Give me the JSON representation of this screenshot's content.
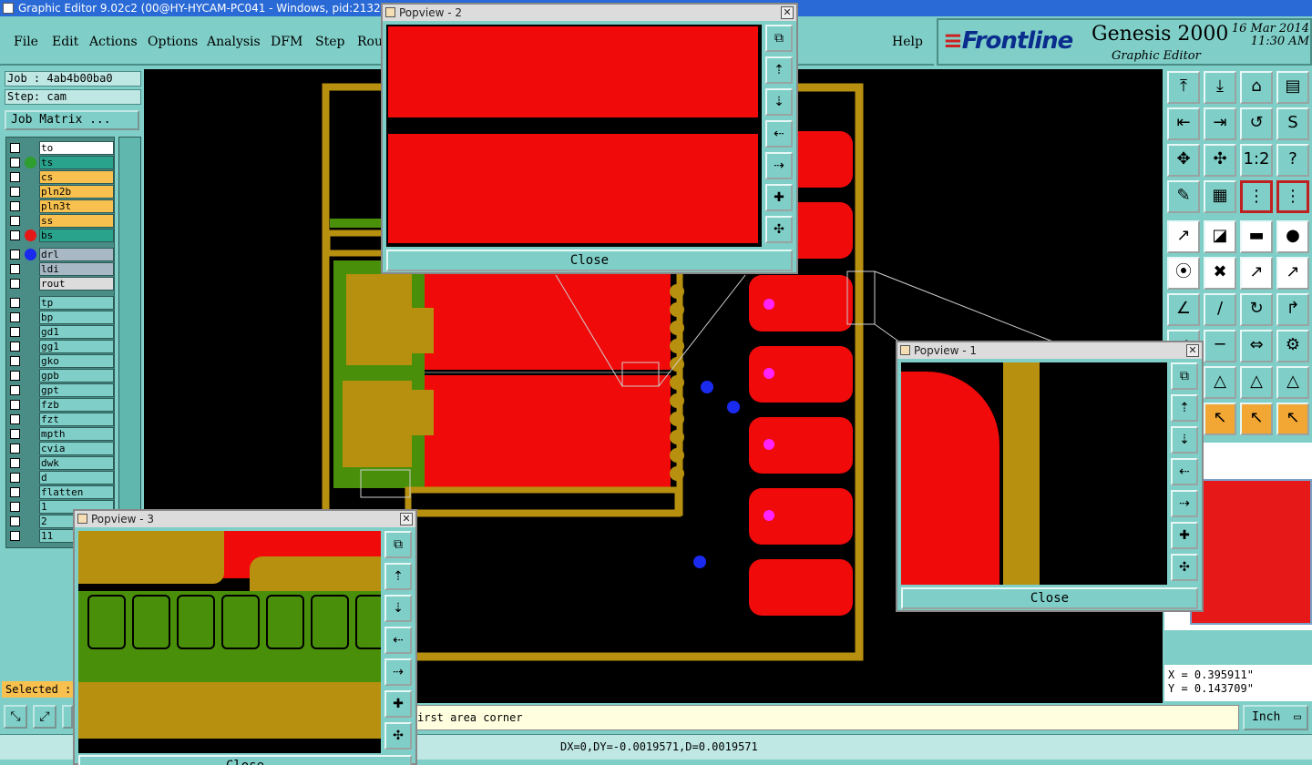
{
  "window": {
    "title": "Graphic Editor 9.02c2 (00@HY-HYCAM-PC041 - Windows, pid:2132)"
  },
  "menu": {
    "items": [
      {
        "label": "File"
      },
      {
        "label": "Edit"
      },
      {
        "label": "Actions"
      },
      {
        "label": "Options"
      },
      {
        "label": "Analysis"
      },
      {
        "label": "DFM"
      },
      {
        "label": "Step"
      },
      {
        "label": "Rou"
      }
    ],
    "help": "Help"
  },
  "brand": {
    "logo": "Frontline",
    "product": "Genesis 2000",
    "subtitle": "Graphic Editor",
    "date": "16 Mar 2014",
    "time": "11:30 AM"
  },
  "job": {
    "job_label": "Job : 4ab4b00ba0",
    "step_label": "Step: cam",
    "matrix_button": "Job Matrix ..."
  },
  "layers": [
    {
      "name": "to",
      "bg": "#ffffff",
      "dot": ""
    },
    {
      "name": "ts",
      "bg": "#2aa38c",
      "dot": "#2e9e2e"
    },
    {
      "name": "cs",
      "bg": "#f7c04f",
      "dot": ""
    },
    {
      "name": "pln2b",
      "bg": "#f7c04f",
      "dot": ""
    },
    {
      "name": "pln3t",
      "bg": "#f7c04f",
      "dot": ""
    },
    {
      "name": "ss",
      "bg": "#f7c04f",
      "dot": ""
    },
    {
      "name": "bs",
      "bg": "#2aa38c",
      "dot": "#e61818"
    },
    {
      "name": "drl",
      "bg": "#a8b8c4",
      "dot": "#1a2aef"
    },
    {
      "name": "ldi",
      "bg": "#a8b8c4",
      "dot": ""
    },
    {
      "name": "rout",
      "bg": "#dcdcdc",
      "dot": ""
    },
    {
      "name": "tp",
      "bg": "#7fcfc8",
      "dot": ""
    },
    {
      "name": "bp",
      "bg": "#7fcfc8",
      "dot": ""
    },
    {
      "name": "gd1",
      "bg": "#7fcfc8",
      "dot": ""
    },
    {
      "name": "gg1",
      "bg": "#7fcfc8",
      "dot": ""
    },
    {
      "name": "gko",
      "bg": "#7fcfc8",
      "dot": ""
    },
    {
      "name": "gpb",
      "bg": "#7fcfc8",
      "dot": ""
    },
    {
      "name": "gpt",
      "bg": "#7fcfc8",
      "dot": ""
    },
    {
      "name": "fzb",
      "bg": "#7fcfc8",
      "dot": ""
    },
    {
      "name": "fzt",
      "bg": "#7fcfc8",
      "dot": ""
    },
    {
      "name": "mpth",
      "bg": "#7fcfc8",
      "dot": ""
    },
    {
      "name": "cvia",
      "bg": "#7fcfc8",
      "dot": ""
    },
    {
      "name": "dwk",
      "bg": "#7fcfc8",
      "dot": ""
    },
    {
      "name": "d",
      "bg": "#7fcfc8",
      "dot": ""
    },
    {
      "name": "flatten",
      "bg": "#7fcfc8",
      "dot": ""
    },
    {
      "name": "1",
      "bg": "#7fcfc8",
      "dot": ""
    },
    {
      "name": "2",
      "bg": "#7fcfc8",
      "dot": ""
    },
    {
      "name": "11",
      "bg": "#7fcfc8",
      "dot": ""
    }
  ],
  "status": {
    "selected": "Selected :",
    "prompt": "irst area corner",
    "delta": "DX=0,DY=-0.0019571,D=0.0019571",
    "units": "Inch",
    "x_coord": "X = 0.395911\"",
    "y_coord": "Y = 0.143709\""
  },
  "popups": {
    "p1": {
      "title": "Popview - 1",
      "close": "Close"
    },
    "p2": {
      "title": "Popview - 2",
      "close": "Close"
    },
    "p3": {
      "title": "Popview - 3",
      "close": "Close"
    }
  },
  "colors": {
    "copper": "#b8900f",
    "pad_red": "#f00a0a",
    "mask_green": "#4a8f0a",
    "drill_blue": "#1a2aef",
    "highlight_magenta": "#ff22ff"
  }
}
